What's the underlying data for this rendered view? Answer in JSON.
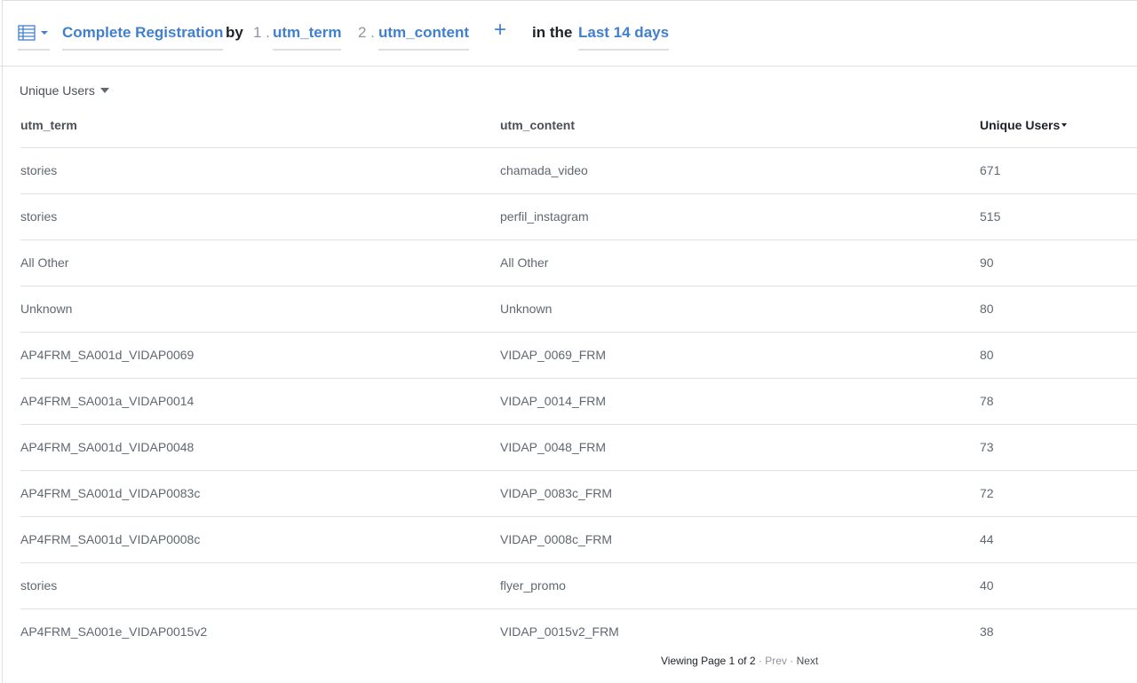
{
  "query": {
    "viz_icon": "table-list-icon",
    "event": "Complete Registration",
    "by_label": "by",
    "breakdowns": [
      {
        "index": "1 .",
        "label": "utm_term"
      },
      {
        "index": "2 .",
        "label": "utm_content"
      }
    ],
    "add_icon": "+",
    "in_the_label": "in the",
    "range": "Last 14 days"
  },
  "metric_selector": "Unique Users",
  "table": {
    "columns": [
      "utm_term",
      "utm_content",
      "Unique Users"
    ],
    "rows": [
      {
        "term": "stories",
        "content": "chamada_video",
        "users": "671"
      },
      {
        "term": "stories",
        "content": "perfil_instagram",
        "users": "515"
      },
      {
        "term": "All Other",
        "content": "All Other",
        "users": "90"
      },
      {
        "term": "Unknown",
        "content": "Unknown",
        "users": "80"
      },
      {
        "term": "AP4FRM_SA001d_VIDAP0069",
        "content": "VIDAP_0069_FRM",
        "users": "80"
      },
      {
        "term": "AP4FRM_SA001a_VIDAP0014",
        "content": "VIDAP_0014_FRM",
        "users": "78"
      },
      {
        "term": "AP4FRM_SA001d_VIDAP0048",
        "content": "VIDAP_0048_FRM",
        "users": "73"
      },
      {
        "term": "AP4FRM_SA001d_VIDAP0083c",
        "content": "VIDAP_0083c_FRM",
        "users": "72"
      },
      {
        "term": "AP4FRM_SA001d_VIDAP0008c",
        "content": "VIDAP_0008c_FRM",
        "users": "44"
      },
      {
        "term": "stories",
        "content": "flyer_promo",
        "users": "40"
      },
      {
        "term": "AP4FRM_SA001e_VIDAP0015v2",
        "content": "VIDAP_0015v2_FRM",
        "users": "38"
      }
    ]
  },
  "pagination": {
    "text": "Viewing Page 1 of 2",
    "sep": "·",
    "prev": "Prev",
    "next": "Next"
  },
  "colors": {
    "link": "#4080cf",
    "border": "#dddfe2",
    "text": "#606770"
  }
}
